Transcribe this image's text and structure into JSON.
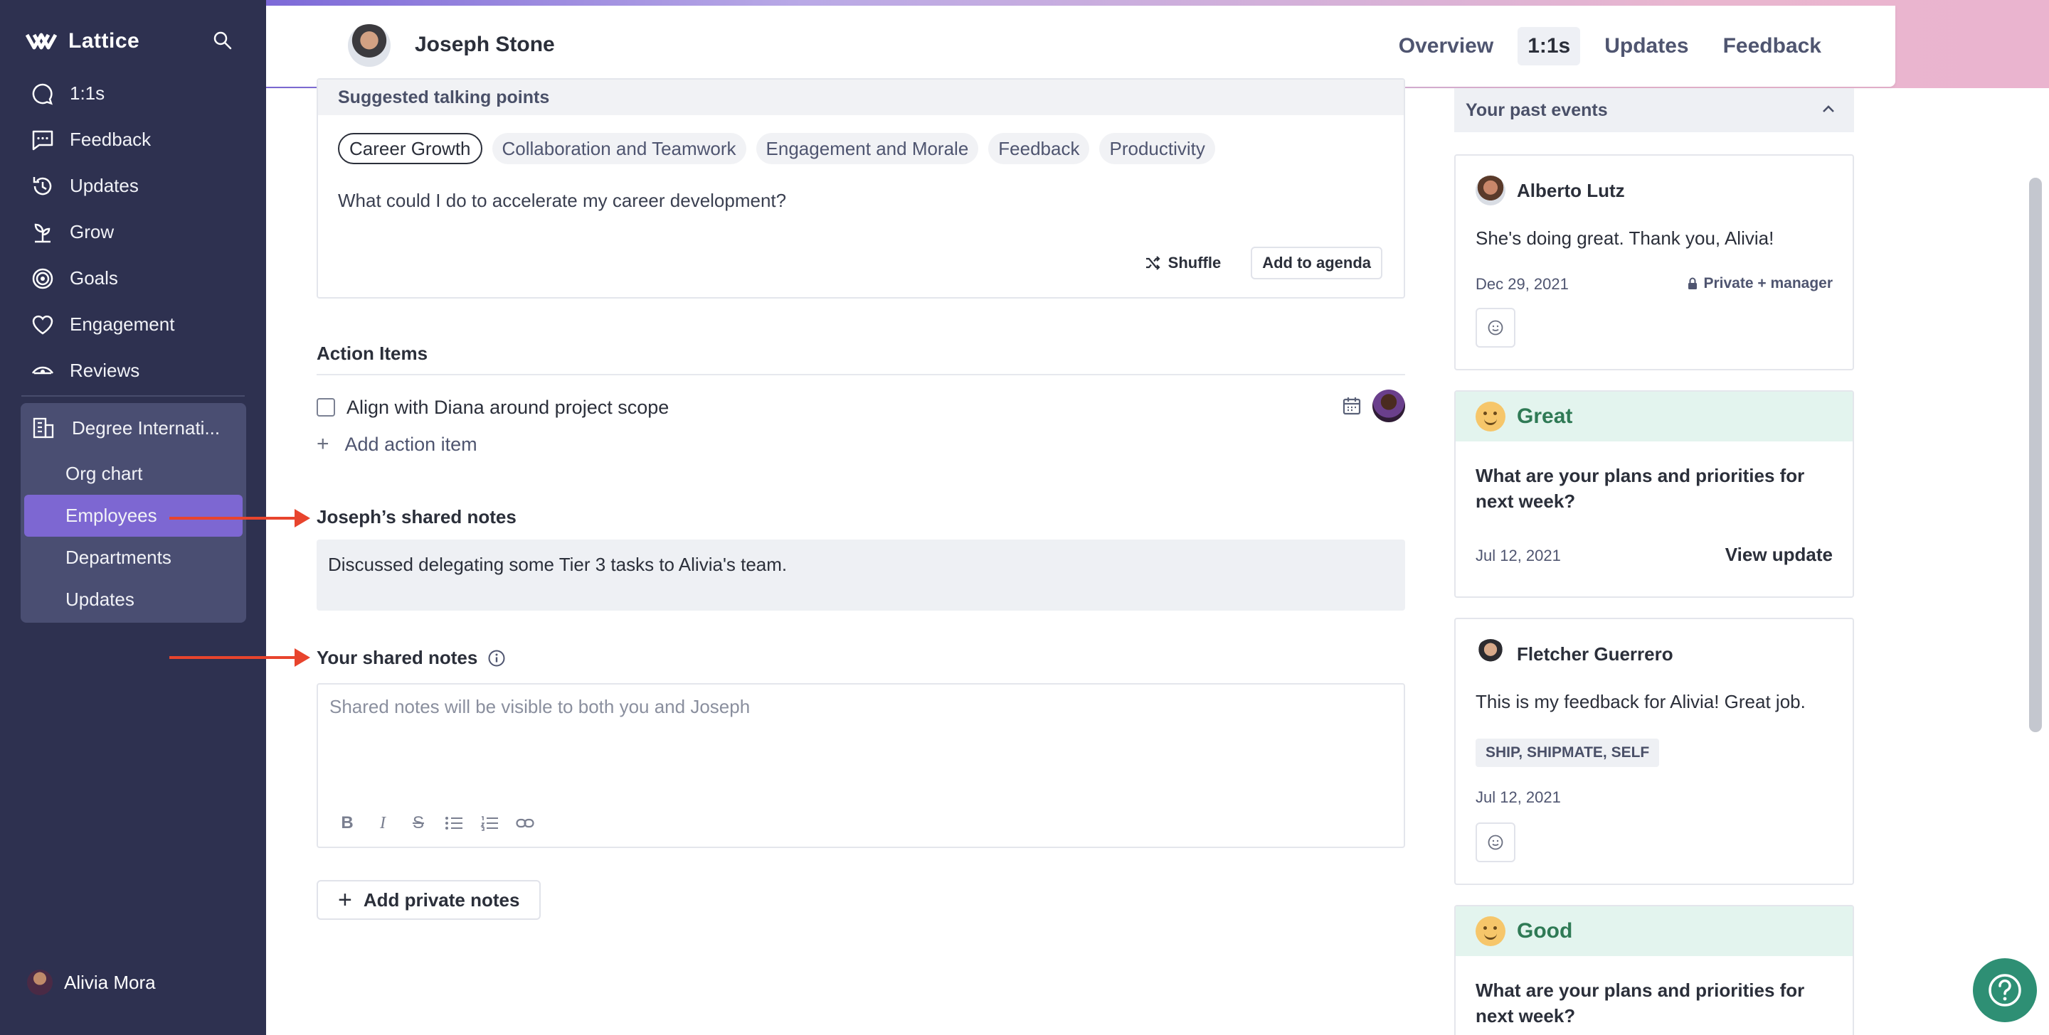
{
  "app": {
    "name": "Lattice"
  },
  "sidebar": {
    "items": [
      {
        "label": "1:1s",
        "icon": "chat-bubble-icon"
      },
      {
        "label": "Feedback",
        "icon": "feedback-message-icon"
      },
      {
        "label": "Updates",
        "icon": "updates-clock-icon"
      },
      {
        "label": "Grow",
        "icon": "grow-sprout-icon"
      },
      {
        "label": "Goals",
        "icon": "goals-target-icon"
      },
      {
        "label": "Engagement",
        "icon": "engagement-heart-icon"
      },
      {
        "label": "Reviews",
        "icon": "reviews-eye-icon"
      }
    ],
    "org": {
      "label": "Degree Internati...",
      "subitems": [
        "Org chart",
        "Employees",
        "Departments",
        "Updates"
      ],
      "active": "Employees"
    },
    "user": {
      "name": "Alivia Mora"
    }
  },
  "header": {
    "person_name": "Joseph Stone",
    "tabs": [
      "Overview",
      "1:1s",
      "Updates",
      "Feedback"
    ],
    "active_tab": "1:1s"
  },
  "talking_points": {
    "title": "Suggested talking points",
    "chips": [
      "Career Growth",
      "Collaboration and Teamwork",
      "Engagement and Morale",
      "Feedback",
      "Productivity"
    ],
    "active_chip": "Career Growth",
    "question": "What could I do to accelerate my career development?",
    "shuffle_label": "Shuffle",
    "add_to_agenda_label": "Add to agenda"
  },
  "action_items": {
    "title": "Action Items",
    "items": [
      {
        "text": "Align with Diana around project scope",
        "checked": false
      }
    ],
    "add_label": "Add action item"
  },
  "josephs_notes": {
    "title": "Joseph’s shared notes",
    "text": "Discussed delegating some Tier 3 tasks to Alivia's team."
  },
  "your_notes": {
    "title": "Your shared notes",
    "placeholder": "Shared notes will be visible to both you and Joseph",
    "value": ""
  },
  "private_notes": {
    "button_label": "Add private notes"
  },
  "past_events": {
    "title": "Your past events",
    "events": [
      {
        "author": "Alberto Lutz",
        "text": "She's doing great. Thank you, Alivia!",
        "date": "Dec 29, 2021",
        "privacy": "Private + manager"
      },
      {
        "mood": "Great",
        "question": "What are your plans and priorities for next week?",
        "date": "Jul 12, 2021",
        "link": "View update"
      },
      {
        "author": "Fletcher Guerrero",
        "text": "This is my feedback for Alivia! Great job.",
        "tag": "SHIP, SHIPMATE, SELF",
        "date": "Jul 12, 2021"
      },
      {
        "mood": "Good",
        "question": "What are your plans and priorities for next week?"
      }
    ]
  },
  "colors": {
    "sidebar_bg": "#2e3150",
    "active_nav": "#7d67d2",
    "mood_green": "#2f7a55",
    "arrow_red": "#e8442d"
  }
}
